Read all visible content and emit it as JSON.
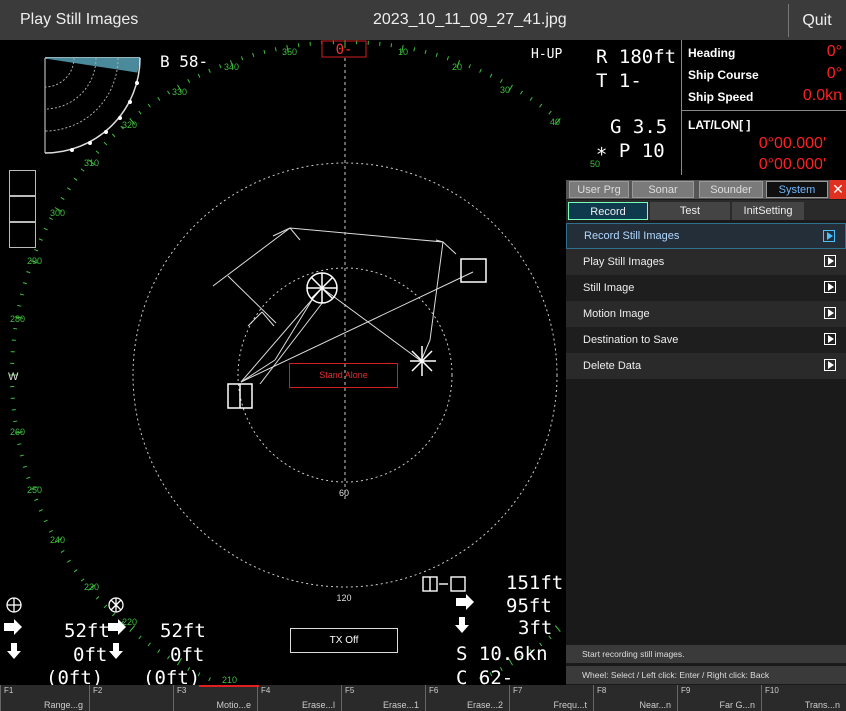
{
  "titlebar": {
    "app": "Play Still Images",
    "file": "2023_10_11_09_27_41.jpg",
    "quit": "Quit"
  },
  "radar": {
    "heading_box": "0-",
    "bearing_labels": [
      "350",
      "10",
      "20",
      "30",
      "40",
      "50",
      "340",
      "330",
      "320",
      "310",
      "300",
      "290",
      "280",
      "270",
      "260",
      "250",
      "240",
      "230",
      "220",
      "210"
    ],
    "west": "W",
    "B": "B  58-",
    "mode": "H-UP",
    "R": "R 180ft",
    "T": "T  1-",
    "G": "G  3.5",
    "P": "∗  P 10",
    "ring_60": "60",
    "ring_120": "120",
    "standalone": "Stand Alone",
    "tx_off": "TX Off",
    "left_depth_1": "52ft",
    "left_depth_2": "0ft",
    "left_depth_3": "(0ft)",
    "mid_depth_1": "52ft",
    "mid_depth_2": "0ft",
    "mid_depth_3": "(0ft)",
    "right_1": "151ft",
    "right_2": "95ft",
    "right_3": "3ft",
    "speed_S": "S  10.6kn",
    "course_C": "C  62-"
  },
  "info": {
    "heading_label": "Heading",
    "heading_val": "0°",
    "course_label": "Ship Course",
    "course_val": "0°",
    "speed_label": "Ship Speed",
    "speed_val": "0.0kn",
    "latlon_label": "LAT/LON[ ]",
    "lat_val": "0°00.000'",
    "lon_val": "0°00.000'"
  },
  "menu": {
    "top_tabs": [
      "User Prg",
      "Sonar",
      "Sounder",
      "System"
    ],
    "sub_tabs": [
      "Record",
      "Test",
      "InitSetting"
    ],
    "items": [
      "Record Still Images",
      "Play Still Images",
      "Still Image",
      "Motion Image",
      "Destination to Save",
      "Delete Data"
    ],
    "hint1": "Start recording still images.",
    "hint2": "Wheel: Select / Left click: Enter / Right click: Back"
  },
  "fkeys": [
    {
      "n": "F1",
      "l": "Range...g"
    },
    {
      "n": "F2",
      "l": ""
    },
    {
      "n": "F3",
      "l": "Motio...e"
    },
    {
      "n": "F4",
      "l": "Erase...l"
    },
    {
      "n": "F5",
      "l": "Erase...1"
    },
    {
      "n": "F6",
      "l": "Erase...2"
    },
    {
      "n": "F7",
      "l": "Frequ...t"
    },
    {
      "n": "F8",
      "l": "Near...n"
    },
    {
      "n": "F9",
      "l": "Far G...n"
    },
    {
      "n": "F10",
      "l": "Trans...n"
    }
  ],
  "colors": {
    "red": "#ff2020",
    "green": "#3fbf3f",
    "accent": "#49c0ff"
  }
}
